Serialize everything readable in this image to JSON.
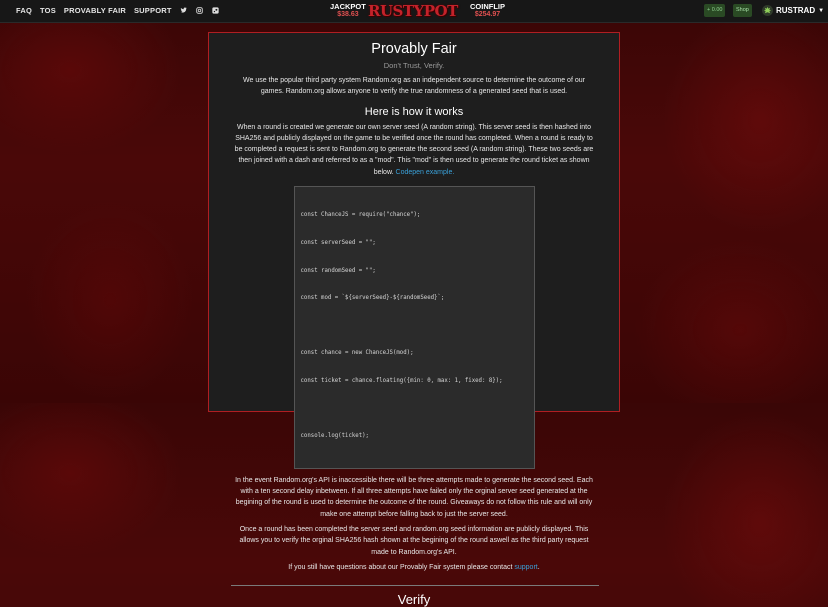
{
  "nav": {
    "items": [
      "FAQ",
      "TOS",
      "PROVABLY FAIR",
      "SUPPORT"
    ]
  },
  "games": {
    "jackpot": {
      "title": "JACKPOT",
      "value": "$38.63"
    },
    "coinflip": {
      "title": "COINFLIP",
      "value": "$254.97"
    }
  },
  "logo": "RUSTYPOT",
  "header": {
    "balance": "+ 0.00",
    "shop": "Shop",
    "username": "RUSTRAD"
  },
  "page": {
    "title": "Provably Fair",
    "subtitle": "Don't Trust, Verify.",
    "intro": "We use the popular third party system Random.org as an independent source to determine the outcome of our games. Random.org allows anyone to verify the true randomness of a generated seed that is used.",
    "how_heading": "Here is how it works",
    "how_text": "When a round is created we generate our own server seed (A random string). This server seed is then hashed into SHA256 and publicly displayed on the game to be verified once the round has completed. When a round is ready to be completed a request is sent to Random.org to generate the second seed (A random string). These two seeds are then joined with a dash and referred to as a \"mod\". This \"mod\" is then used to generate the round ticket as shown below.",
    "codepen_link": "Codepen example.",
    "code_lines": [
      "const ChanceJS = require(\"chance\");",
      "const serverSeed = \"\";",
      "const randomSeed = \"\";",
      "const mod = `${serverSeed}-${randomSeed}`;",
      "",
      "const chance = new ChanceJS(mod);",
      "const ticket = chance.floating({min: 0, max: 1, fixed: 8});",
      "",
      "console.log(ticket);"
    ],
    "api_text": "In the event Random.org's API is inaccessible there will be three attempts made to generate the second seed. Each with a ten second delay inbetween. If all three attempts have failed only the orginal server seed generated at the begining of the round is used to determine the outcome of the round. Giveaways do not follow this rule and will only make one attempt before falling back to just the server seed.",
    "complete_text": "Once a round has been completed the server seed and random.org seed information are publicly displayed. This allows you to verify the orginal SHA256 hash shown at the begining of the round aswell as the third party request made to Random.org's API.",
    "questions_text": "If you still have questions about our Provably Fair system please contact",
    "support_link": "support",
    "period": ".",
    "verify_heading": "Verify"
  }
}
